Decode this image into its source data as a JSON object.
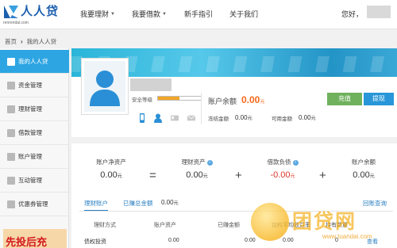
{
  "header": {
    "logo_text": "人人贷",
    "logo_sub": "renrendai.com",
    "nav": [
      {
        "label": "我要理财",
        "has_caret": true
      },
      {
        "label": "我要借款",
        "has_caret": true
      },
      {
        "label": "新手指引",
        "has_caret": false
      },
      {
        "label": "关于我们",
        "has_caret": false
      }
    ],
    "greeting": "您好，"
  },
  "breadcrumb": {
    "home": "首页",
    "separator": "›",
    "current": "我的人人贷"
  },
  "sidebar": {
    "items": [
      {
        "label": "我的人人贷",
        "active": true
      },
      {
        "label": "资金管理",
        "active": false
      },
      {
        "label": "理财管理",
        "active": false
      },
      {
        "label": "借款管理",
        "active": false
      },
      {
        "label": "账户管理",
        "active": false
      },
      {
        "label": "互动管理",
        "active": false
      },
      {
        "label": "优惠券管理",
        "active": false
      }
    ],
    "promo_text": "先投后充"
  },
  "profile": {
    "security_label": "安全等级",
    "security_level": 0.5,
    "balance_label": "账户余额",
    "balance_value": "0.00",
    "balance_unit": "元",
    "frozen_label": "冻结金额",
    "frozen_value": "0.00",
    "frozen_unit": "元",
    "available_label": "可用金额",
    "available_value": "0.00",
    "available_unit": "元",
    "recharge_button": "充值",
    "withdraw_button": "提现",
    "verify_icons": [
      "phone-icon",
      "user-icon",
      "id-card-icon",
      "mail-icon"
    ]
  },
  "summary": {
    "net_assets_label": "账户净资产",
    "net_assets_value": "0.00",
    "fin_assets_label": "理财资产",
    "fin_assets_value": "0.00",
    "debt_label": "借款负债",
    "debt_value": "-0.00",
    "balance_label": "账户余额",
    "balance_value": "0.00",
    "unit": "元",
    "op_equals": "=",
    "op_plus1": "+",
    "op_plus2": "+"
  },
  "tabs": {
    "fin_account": "理财账户",
    "earned_label": "已赚总金额",
    "earned_value": "0.00",
    "earned_unit": "元",
    "right_link": "回账查询"
  },
  "table": {
    "headers": [
      "理财方式",
      "账户资产",
      "已赚金额",
      "加权平均收益率",
      "持有数量"
    ],
    "rows": [
      {
        "method": "债权投资",
        "assets": "0.00",
        "earned": "0.00",
        "rate": "0.00",
        "count": "0",
        "action": "查看"
      }
    ]
  },
  "watermark": {
    "brand": "团贷网",
    "url": "www.tuandai.com"
  },
  "colors": {
    "active_sidebar": "#2da5e3",
    "balance": "#f56a1e",
    "recharge": "#6fb15d",
    "withdraw": "#2896d8",
    "negative": "#d9362b",
    "link": "#2a7fc2"
  }
}
